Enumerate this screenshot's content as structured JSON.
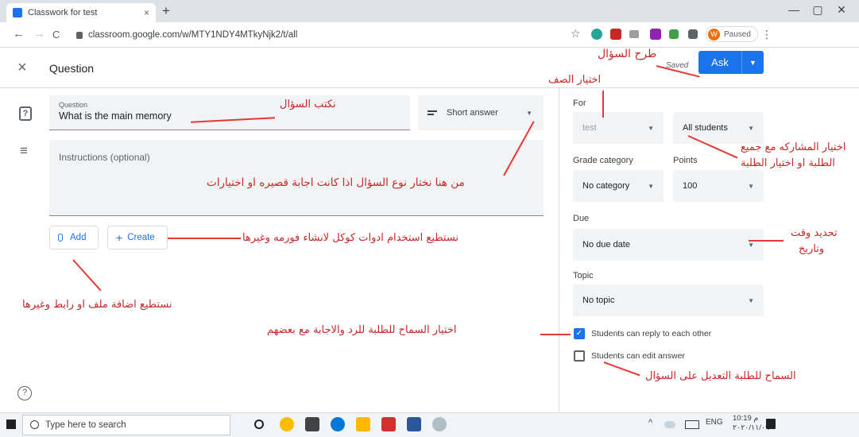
{
  "browser": {
    "tab_title": "Classwork for test",
    "tab_close": "×",
    "new_tab": "+",
    "url": "classroom.google.com/w/MTY1NDY4MTkyNjk2/t/all",
    "profile_initial": "W",
    "profile_status": "Paused",
    "window_controls": [
      "—",
      "▢",
      "✕"
    ],
    "nav_icons": [
      "←",
      "→",
      "C"
    ],
    "menu_icon": "⋮",
    "star_icon": "☆"
  },
  "header": {
    "close_icon": "×",
    "title": "Question",
    "saved": "Saved",
    "ask_label": "Ask",
    "ask_dropdown": "▼"
  },
  "form": {
    "question_label": "Question",
    "question_value": "What is the main memory",
    "type_value": "Short answer",
    "instructions_placeholder": "Instructions (optional)",
    "add_label": "Add",
    "create_label": "Create",
    "question_icon": "?",
    "instructions_icon": "≡",
    "help_icon": "?"
  },
  "panel": {
    "for_label": "For",
    "class_value": "test",
    "students_value": "All students",
    "grade_label": "Grade category",
    "points_label": "Points",
    "grade_value": "No category",
    "points_value": "100",
    "due_label": "Due",
    "due_value": "No due date",
    "topic_label": "Topic",
    "topic_value": "No topic",
    "reply_label": "Students can reply to each other",
    "reply_checked": true,
    "edit_label": "Students can edit answer",
    "edit_checked": false,
    "dropdown_icon": "▼"
  },
  "annotations": {
    "ask": "طرح السؤال",
    "class": "اختيار الصف",
    "question": "نكتب السؤال",
    "students_line1": "اختيار المشاركه مع جميع",
    "students_line2": "الطلبة او اختيار الطلبة",
    "type": "من هنا نختار نوع السؤال اذا كانت اجابة قصيره او اختيارات",
    "create": "نستطيع استخدام ادوات كوكل لانشاء فورمه وغيرها",
    "due_line1": "تحديد وقت",
    "due_line2": "وتاريخ",
    "add": "نستطيع اضافة ملف او  رابط وغيرها",
    "reply": "اختيار السماح للطلبة للرد والاجابة مع بعضهم",
    "edit": "السماح للطلبة التعديل على السؤال"
  },
  "taskbar": {
    "search_placeholder": "Type here to search",
    "language": "ENG",
    "time": "10:19 م",
    "date": "٢٠٢٠/١١/٠٩"
  }
}
